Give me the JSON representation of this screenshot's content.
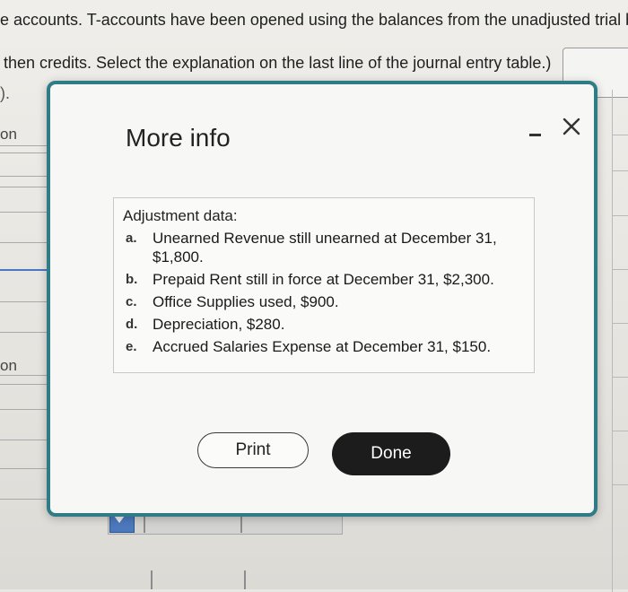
{
  "background": {
    "line1": "e accounts. T-accounts have been opened using the balances from the unadjusted trial b",
    "line2": "then credits. Select the explanation on the last line of the journal entry table.)",
    "marker": ").",
    "column_label_1": "on",
    "column_label_2": "on"
  },
  "modal": {
    "title": "More info",
    "minimize_icon": "minimize-icon",
    "close_icon": "close-icon",
    "adjustment_heading": "Adjustment data:",
    "items": [
      {
        "letter": "a.",
        "text": "Unearned Revenue still unearned at December 31, $1,800."
      },
      {
        "letter": "b.",
        "text": "Prepaid Rent still in force at December 31, $2,300."
      },
      {
        "letter": "c.",
        "text": "Office Supplies used, $900."
      },
      {
        "letter": "d.",
        "text": "Depreciation, $280."
      },
      {
        "letter": "e.",
        "text": "Accrued Salaries Expense at December 31, $150."
      }
    ],
    "print_label": "Print",
    "done_label": "Done"
  },
  "colors": {
    "modal_border": "#2f7c86",
    "done_button": "#1c1c1c",
    "table_accent": "#4a78c2"
  }
}
